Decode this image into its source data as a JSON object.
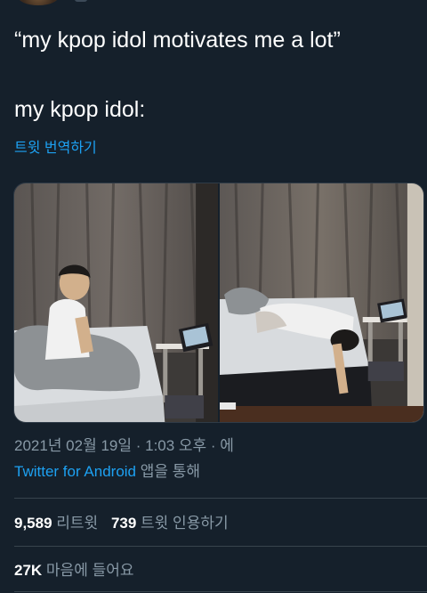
{
  "tweet": {
    "text_line_1": "“my kpop idol motivates me a lot”",
    "text_line_2": "my kpop idol:",
    "translate_label": "트윗 번역하기"
  },
  "media": {
    "photos": [
      {
        "label": "photo-1"
      },
      {
        "label": "photo-2"
      }
    ]
  },
  "meta": {
    "timestamp": "2021년 02월 19일 · 1:03 오후 · 에",
    "source_app": "Twitter for Android",
    "source_suffix": " 앱을 통해"
  },
  "stats": {
    "retweets_count": "9,589",
    "retweets_label": "리트윗",
    "quotes_count": "739",
    "quotes_label": "트윗 인용하기",
    "likes_count": "27K",
    "likes_label": "마음에 들어요"
  },
  "colors": {
    "background": "#15202b",
    "link": "#1da1f2",
    "secondary_text": "#8899a6",
    "divider": "#38444d"
  }
}
